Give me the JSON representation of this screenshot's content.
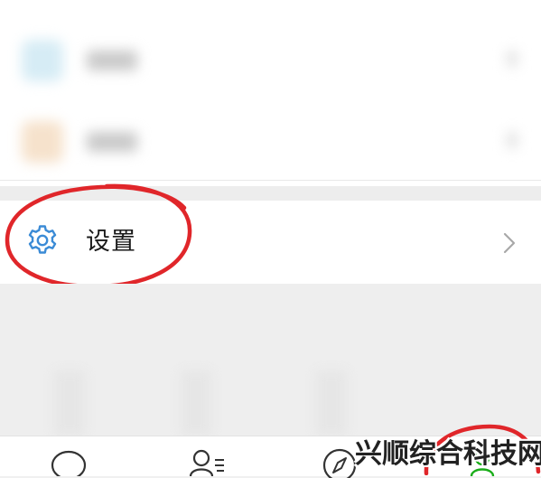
{
  "settings_item": {
    "label": "设置",
    "icon": "gear-icon",
    "chevron": "chevron-right-icon"
  },
  "blurred_items": [
    {
      "icon_color": "#d6ecf5",
      "text_color": "#c9c9c9"
    },
    {
      "icon_color": "#f6e2cc",
      "text_color": "#c9c9c9"
    }
  ],
  "bottom_nav": [
    {
      "icon": "chat-bubble-icon"
    },
    {
      "icon": "contacts-icon"
    },
    {
      "icon": "compass-icon"
    },
    {
      "icon": "me-icon",
      "active": true
    }
  ],
  "watermark": "兴顺综合科技网",
  "colors": {
    "annotation_red": "#e0262a",
    "gear_blue": "#3b8bd6",
    "active_green": "#1aad19"
  }
}
